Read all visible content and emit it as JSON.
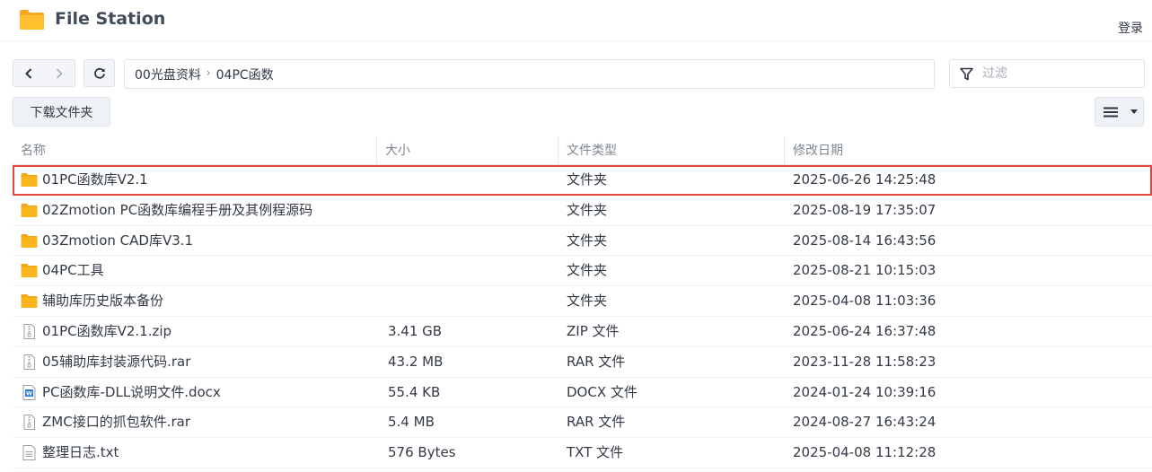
{
  "app": {
    "title": "File Station",
    "login": "登录"
  },
  "path": {
    "crumbs": [
      "00光盘资料",
      "04PC函数"
    ],
    "separator": "›"
  },
  "filter": {
    "placeholder": "过滤"
  },
  "toolbar": {
    "download_label": "下载文件夹"
  },
  "icons": {
    "back": "chevron-left-icon",
    "forward": "chevron-right-icon",
    "refresh": "refresh-icon",
    "filter": "filter-icon",
    "list_view": "list-view-icon",
    "folder": "folder-icon",
    "zip": "archive-file-icon",
    "docx": "word-file-icon",
    "txt": "text-file-icon"
  },
  "colors": {
    "folder": "#f8b51c",
    "selection": "#e6443e",
    "word": "#2b79d6"
  },
  "table": {
    "headers": {
      "name": "名称",
      "size": "大小",
      "type": "文件类型",
      "modified": "修改日期"
    },
    "rows": [
      {
        "name": "01PC函数库V2.1",
        "size": "",
        "type": "文件夹",
        "modified": "2025-06-26 14:25:48",
        "icon": "folder",
        "selected": true
      },
      {
        "name": "02Zmotion PC函数库编程手册及其例程源码",
        "size": "",
        "type": "文件夹",
        "modified": "2025-08-19 17:35:07",
        "icon": "folder"
      },
      {
        "name": "03Zmotion CAD库V3.1",
        "size": "",
        "type": "文件夹",
        "modified": "2025-08-14 16:43:56",
        "icon": "folder"
      },
      {
        "name": "04PC工具",
        "size": "",
        "type": "文件夹",
        "modified": "2025-08-21 10:15:03",
        "icon": "folder"
      },
      {
        "name": "辅助库历史版本备份",
        "size": "",
        "type": "文件夹",
        "modified": "2025-04-08 11:03:36",
        "icon": "folder"
      },
      {
        "name": "01PC函数库V2.1.zip",
        "size": "3.41 GB",
        "type": "ZIP 文件",
        "modified": "2025-06-24 16:37:48",
        "icon": "zip"
      },
      {
        "name": "05辅助库封装源代码.rar",
        "size": "43.2 MB",
        "type": "RAR 文件",
        "modified": "2023-11-28 11:58:23",
        "icon": "zip"
      },
      {
        "name": "PC函数库-DLL说明文件.docx",
        "size": "55.4 KB",
        "type": "DOCX 文件",
        "modified": "2024-01-24 10:39:16",
        "icon": "docx"
      },
      {
        "name": "ZMC接口的抓包软件.rar",
        "size": "5.4 MB",
        "type": "RAR 文件",
        "modified": "2024-08-27 16:43:24",
        "icon": "zip"
      },
      {
        "name": "整理日志.txt",
        "size": "576 Bytes",
        "type": "TXT 文件",
        "modified": "2025-04-08 11:12:28",
        "icon": "txt"
      }
    ]
  }
}
